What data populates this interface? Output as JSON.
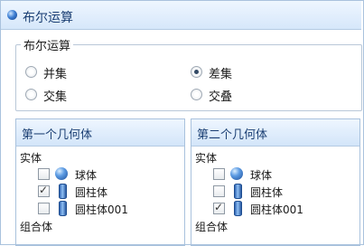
{
  "window": {
    "title": "布尔运算",
    "icon": "sphere-icon"
  },
  "boolean_group": {
    "legend": "布尔运算",
    "options": [
      {
        "label": "并集",
        "selected": false
      },
      {
        "label": "差集",
        "selected": true
      },
      {
        "label": "交集",
        "selected": false
      },
      {
        "label": "交叠",
        "selected": false
      }
    ]
  },
  "panels": [
    {
      "header": "第一个几何体",
      "solid_label": "实体",
      "items": [
        {
          "label": "球体",
          "checked": false,
          "icon": "sphere-icon"
        },
        {
          "label": "圆柱体",
          "checked": true,
          "icon": "cylinder-icon"
        },
        {
          "label": "圆柱体001",
          "checked": false,
          "icon": "cylinder-icon"
        }
      ],
      "compound_label": "组合体"
    },
    {
      "header": "第二个几何体",
      "solid_label": "实体",
      "items": [
        {
          "label": "球体",
          "checked": false,
          "icon": "sphere-icon"
        },
        {
          "label": "圆柱体",
          "checked": false,
          "icon": "cylinder-icon"
        },
        {
          "label": "圆柱体001",
          "checked": true,
          "icon": "cylinder-icon"
        }
      ],
      "compound_label": "组合体"
    }
  ]
}
